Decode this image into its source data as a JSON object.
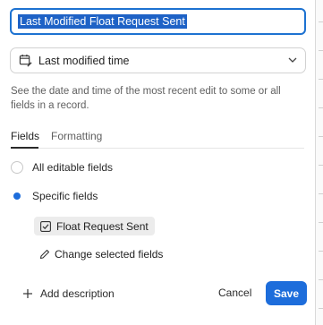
{
  "field_name": {
    "value": "Last Modified Float Request Sent"
  },
  "field_type": {
    "label": "Last modified time",
    "icon": "calendar-edit-icon"
  },
  "description": "See the date and time of the most recent edit to some or all fields in a record.",
  "tabs": [
    {
      "label": "Fields",
      "active": true
    },
    {
      "label": "Formatting",
      "active": false
    }
  ],
  "options": [
    {
      "label": "All editable fields",
      "selected": false
    },
    {
      "label": "Specific fields",
      "selected": true
    }
  ],
  "selected_field": {
    "label": "Float Request Sent",
    "icon": "checkbox-icon"
  },
  "change_fields": {
    "label": "Change selected fields",
    "icon": "pencil-icon"
  },
  "footer": {
    "add_description": "Add description",
    "cancel": "Cancel",
    "save": "Save"
  },
  "colors": {
    "accent": "#1d6ddb",
    "selection": "#1e62c6",
    "chip_bg": "#ececec"
  }
}
